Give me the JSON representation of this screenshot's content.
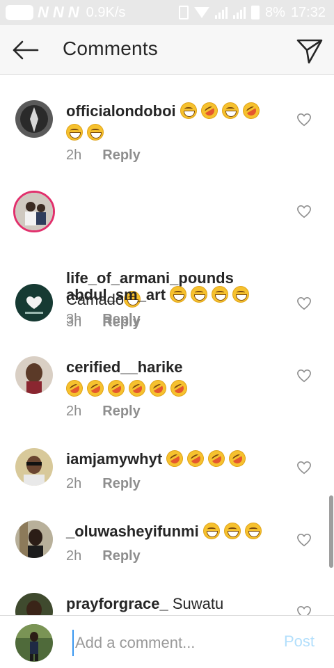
{
  "status_bar": {
    "icons": [
      "notification-pill-icon",
      "n-icon",
      "n-icon",
      "n-icon"
    ],
    "speed": "0.9K/s",
    "battery": "8%",
    "time": "17:32"
  },
  "header": {
    "title": "Comments",
    "back_icon": "arrow-left-icon",
    "send_icon": "paper-plane-icon"
  },
  "comments": [
    {
      "username": "officialondoboi",
      "text": "",
      "emoji": [
        "grin",
        "rofl",
        "grin",
        "rofl",
        "grin",
        "grin"
      ],
      "time": "2h",
      "reply": "Reply"
    },
    {
      "username": "life_of_armani_pounds",
      "text": "Camado",
      "emoji": [
        "grin"
      ],
      "time": "3h",
      "reply": "Reply"
    },
    {
      "username": "abdul_sm_art",
      "text": "",
      "emoji": [
        "grin",
        "grin",
        "grin",
        "grin"
      ],
      "time": "3h",
      "reply": "Reply"
    },
    {
      "username": "cerified__harike",
      "text": "",
      "emoji": [
        "rofl",
        "rofl",
        "rofl",
        "rofl",
        "rofl",
        "rofl"
      ],
      "time": "2h",
      "reply": "Reply"
    },
    {
      "username": "iamjamywhyt",
      "text": "",
      "emoji": [
        "rofl",
        "rofl",
        "rofl",
        "rofl"
      ],
      "time": "2h",
      "reply": "Reply"
    },
    {
      "username": "_oluwasheyifunmi",
      "text": "",
      "emoji": [
        "grin",
        "grin",
        "grin"
      ],
      "time": "2h",
      "reply": "Reply"
    },
    {
      "username": "prayforgrace_",
      "text": "Suwatu",
      "emoji": [],
      "time": "",
      "reply": ""
    }
  ],
  "composer": {
    "placeholder": "Add a comment...",
    "post_label": "Post"
  },
  "colors": {
    "link_blue": "#3897f0",
    "post_disabled": "#b2dffc",
    "secondary_text": "#8e8e8e",
    "primary_text": "#262626",
    "emoji_yellow": "#f6c12e"
  }
}
